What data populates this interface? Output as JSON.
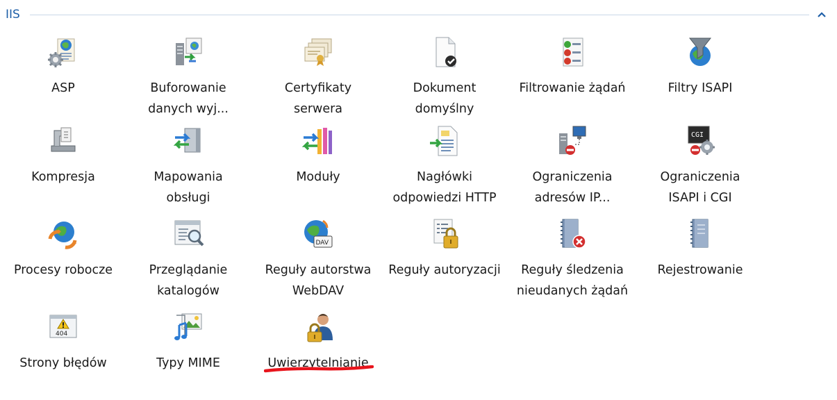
{
  "group": {
    "title": "IIS",
    "collapse_glyph": "⌃"
  },
  "features": [
    {
      "name": "asp-icon-tile",
      "label": "ASP",
      "icon": "asp-icon"
    },
    {
      "name": "output-caching",
      "label": "Buforowanie\ndanych wyj...",
      "icon": "output-caching-icon"
    },
    {
      "name": "server-certificates",
      "label": "Certyfikaty\nserwera",
      "icon": "certificates-icon"
    },
    {
      "name": "default-document",
      "label": "Dokument\ndomyślny",
      "icon": "default-document-icon"
    },
    {
      "name": "request-filtering",
      "label": "Filtrowanie żądań",
      "icon": "request-filtering-icon"
    },
    {
      "name": "isapi-filters",
      "label": "Filtry ISAPI",
      "icon": "isapi-filters-icon"
    },
    {
      "name": "compression",
      "label": "Kompresja",
      "icon": "compression-icon"
    },
    {
      "name": "handler-mappings",
      "label": "Mapowania\nobsługi",
      "icon": "handler-mappings-icon"
    },
    {
      "name": "modules",
      "label": "Moduły",
      "icon": "modules-icon"
    },
    {
      "name": "http-response-headers",
      "label": "Nagłówki\nodpowiedzi HTTP",
      "icon": "response-headers-icon"
    },
    {
      "name": "ip-restrictions",
      "label": "Ograniczenia\nadresów IP...",
      "icon": "ip-restrictions-icon"
    },
    {
      "name": "isapi-cgi-restrictions",
      "label": "Ograniczenia\nISAPI i CGI",
      "icon": "isapi-cgi-icon"
    },
    {
      "name": "worker-processes",
      "label": "Procesy robocze",
      "icon": "worker-processes-icon"
    },
    {
      "name": "directory-browsing",
      "label": "Przeglądanie\nkatalogów",
      "icon": "directory-browsing-icon"
    },
    {
      "name": "webdav-authoring-rules",
      "label": "Reguły autorstwa\nWebDAV",
      "icon": "webdav-icon"
    },
    {
      "name": "authorization-rules",
      "label": "Reguły autoryzacji",
      "icon": "authorization-lock-icon"
    },
    {
      "name": "failed-request-tracing",
      "label": "Reguły śledzenia\nnieudanych żądań",
      "icon": "failed-request-tracing-icon"
    },
    {
      "name": "logging",
      "label": "Rejestrowanie",
      "icon": "logging-notebook-icon"
    },
    {
      "name": "error-pages",
      "label": "Strony błędów",
      "icon": "error-pages-icon"
    },
    {
      "name": "mime-types",
      "label": "Typy MIME",
      "icon": "mime-types-icon"
    },
    {
      "name": "authentication",
      "label": "Uwierzytelnianie",
      "icon": "authentication-icon"
    }
  ],
  "highlight_color": "#e8141c"
}
